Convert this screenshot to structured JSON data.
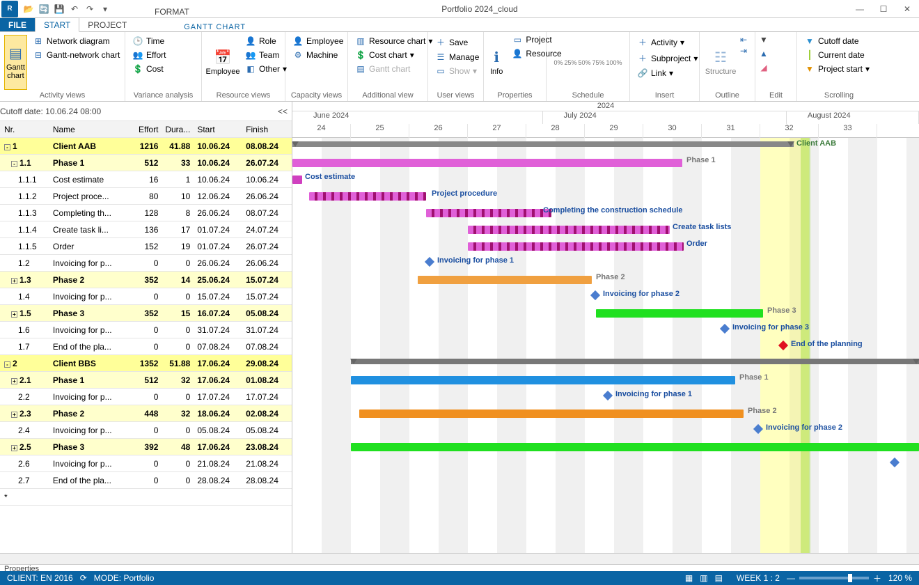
{
  "app": {
    "title": "Portfolio 2024_cloud",
    "context_tab": "GANTT CHART"
  },
  "tabs": [
    "FILE",
    "START",
    "PROJECT",
    "FORMAT"
  ],
  "ribbon": {
    "activity_views": {
      "gantt": "Gantt chart",
      "network": "Network diagram",
      "gantt_net": "Gantt-network chart",
      "label": "Activity views"
    },
    "variance": {
      "time": "Time",
      "effort": "Effort",
      "cost": "Cost",
      "label": "Variance analysis"
    },
    "resource_views": {
      "employee": "Employee",
      "role": "Role",
      "team": "Team",
      "other": "Other",
      "label": "Resource views"
    },
    "capacity": {
      "employee": "Employee",
      "machine": "Machine",
      "label": "Capacity views"
    },
    "additional": {
      "resource_chart": "Resource chart",
      "cost_chart": "Cost chart",
      "gantt_chart": "Gantt chart",
      "label": "Additional view"
    },
    "user": {
      "save": "Save",
      "manage": "Manage",
      "show": "Show",
      "label": "User views"
    },
    "properties": {
      "project": "Project",
      "resource": "Resource",
      "info": "Info",
      "label": "Properties"
    },
    "schedule": {
      "label": "Schedule"
    },
    "insert": {
      "activity": "Activity",
      "subproject": "Subproject",
      "link": "Link",
      "label": "Insert"
    },
    "outline": {
      "structure": "Structure",
      "label": "Outline"
    },
    "edit": {
      "label": "Edit"
    },
    "scrolling": {
      "cutoff": "Cutoff date",
      "current": "Current date",
      "project_start": "Project start",
      "label": "Scrolling"
    }
  },
  "cutoff": "Cutoff date: 10.06.24 08:00",
  "columns": {
    "nr": "Nr.",
    "name": "Name",
    "effort": "Effort",
    "dura": "Dura...",
    "start": "Start",
    "finish": "Finish"
  },
  "rows": [
    {
      "nr": "1",
      "name": "Client AAB",
      "effort": "1216",
      "dur": "41.88",
      "start": "10.06.24",
      "finish": "08.08.24",
      "level": 0,
      "expand": "-"
    },
    {
      "nr": "1.1",
      "name": "Phase 1",
      "effort": "512",
      "dur": "33",
      "start": "10.06.24",
      "finish": "26.07.24",
      "level": 1,
      "expand": "-"
    },
    {
      "nr": "1.1.1",
      "name": "Cost estimate",
      "effort": "16",
      "dur": "1",
      "start": "10.06.24",
      "finish": "10.06.24",
      "level": 2
    },
    {
      "nr": "1.1.2",
      "name": "Project proce...",
      "effort": "80",
      "dur": "10",
      "start": "12.06.24",
      "finish": "26.06.24",
      "level": 2
    },
    {
      "nr": "1.1.3",
      "name": "Completing th...",
      "effort": "128",
      "dur": "8",
      "start": "26.06.24",
      "finish": "08.07.24",
      "level": 2
    },
    {
      "nr": "1.1.4",
      "name": "Create task li...",
      "effort": "136",
      "dur": "17",
      "start": "01.07.24",
      "finish": "24.07.24",
      "level": 2
    },
    {
      "nr": "1.1.5",
      "name": "Order",
      "effort": "152",
      "dur": "19",
      "start": "01.07.24",
      "finish": "26.07.24",
      "level": 2
    },
    {
      "nr": "1.2",
      "name": "Invoicing for p...",
      "effort": "0",
      "dur": "0",
      "start": "26.06.24",
      "finish": "26.06.24",
      "level": 2
    },
    {
      "nr": "1.3",
      "name": "Phase 2",
      "effort": "352",
      "dur": "14",
      "start": "25.06.24",
      "finish": "15.07.24",
      "level": 1,
      "expand": "+"
    },
    {
      "nr": "1.4",
      "name": "Invoicing for p...",
      "effort": "0",
      "dur": "0",
      "start": "15.07.24",
      "finish": "15.07.24",
      "level": 2
    },
    {
      "nr": "1.5",
      "name": "Phase 3",
      "effort": "352",
      "dur": "15",
      "start": "16.07.24",
      "finish": "05.08.24",
      "level": 1,
      "expand": "+"
    },
    {
      "nr": "1.6",
      "name": "Invoicing for p...",
      "effort": "0",
      "dur": "0",
      "start": "31.07.24",
      "finish": "31.07.24",
      "level": 2
    },
    {
      "nr": "1.7",
      "name": "End of the pla...",
      "effort": "0",
      "dur": "0",
      "start": "07.08.24",
      "finish": "07.08.24",
      "level": 2
    },
    {
      "nr": "2",
      "name": "Client BBS",
      "effort": "1352",
      "dur": "51.88",
      "start": "17.06.24",
      "finish": "29.08.24",
      "level": 0,
      "expand": "-"
    },
    {
      "nr": "2.1",
      "name": "Phase 1",
      "effort": "512",
      "dur": "32",
      "start": "17.06.24",
      "finish": "01.08.24",
      "level": 1,
      "expand": "+"
    },
    {
      "nr": "2.2",
      "name": "Invoicing for p...",
      "effort": "0",
      "dur": "0",
      "start": "17.07.24",
      "finish": "17.07.24",
      "level": 2
    },
    {
      "nr": "2.3",
      "name": "Phase 2",
      "effort": "448",
      "dur": "32",
      "start": "18.06.24",
      "finish": "02.08.24",
      "level": 1,
      "expand": "+"
    },
    {
      "nr": "2.4",
      "name": "Invoicing for p...",
      "effort": "0",
      "dur": "0",
      "start": "05.08.24",
      "finish": "05.08.24",
      "level": 2
    },
    {
      "nr": "2.5",
      "name": "Phase 3",
      "effort": "392",
      "dur": "48",
      "start": "17.06.24",
      "finish": "23.08.24",
      "level": 1,
      "expand": "+"
    },
    {
      "nr": "2.6",
      "name": "Invoicing for p...",
      "effort": "0",
      "dur": "0",
      "start": "21.08.24",
      "finish": "21.08.24",
      "level": 2
    },
    {
      "nr": "2.7",
      "name": "End of the pla...",
      "effort": "0",
      "dur": "0",
      "start": "28.08.24",
      "finish": "28.08.24",
      "level": 2
    }
  ],
  "timeline": {
    "year": "2024",
    "months": [
      "June 2024",
      "July 2024",
      "August 2024"
    ],
    "weeks": [
      "24",
      "25",
      "26",
      "27",
      "28",
      "29",
      "30",
      "31",
      "32",
      "33"
    ]
  },
  "gantt_labels": {
    "client_aab": "Client AAB",
    "phase1": "Phase 1",
    "cost_est": "Cost estimate",
    "proj_proc": "Project procedure",
    "completing": "Completing the construction schedule",
    "create_task": "Create task lists",
    "order": "Order",
    "inv1": "Invoicing for phase 1",
    "phase2": "Phase 2",
    "inv2": "Invoicing for phase 2",
    "phase3": "Phase 3",
    "inv3": "Invoicing for phase 3",
    "end_plan": "End of the planning"
  },
  "properties_label": "Properties",
  "status": {
    "client": "CLIENT: EN 2016",
    "mode": "MODE: Portfolio",
    "week": "WEEK 1 : 2",
    "zoom": "120 %"
  }
}
